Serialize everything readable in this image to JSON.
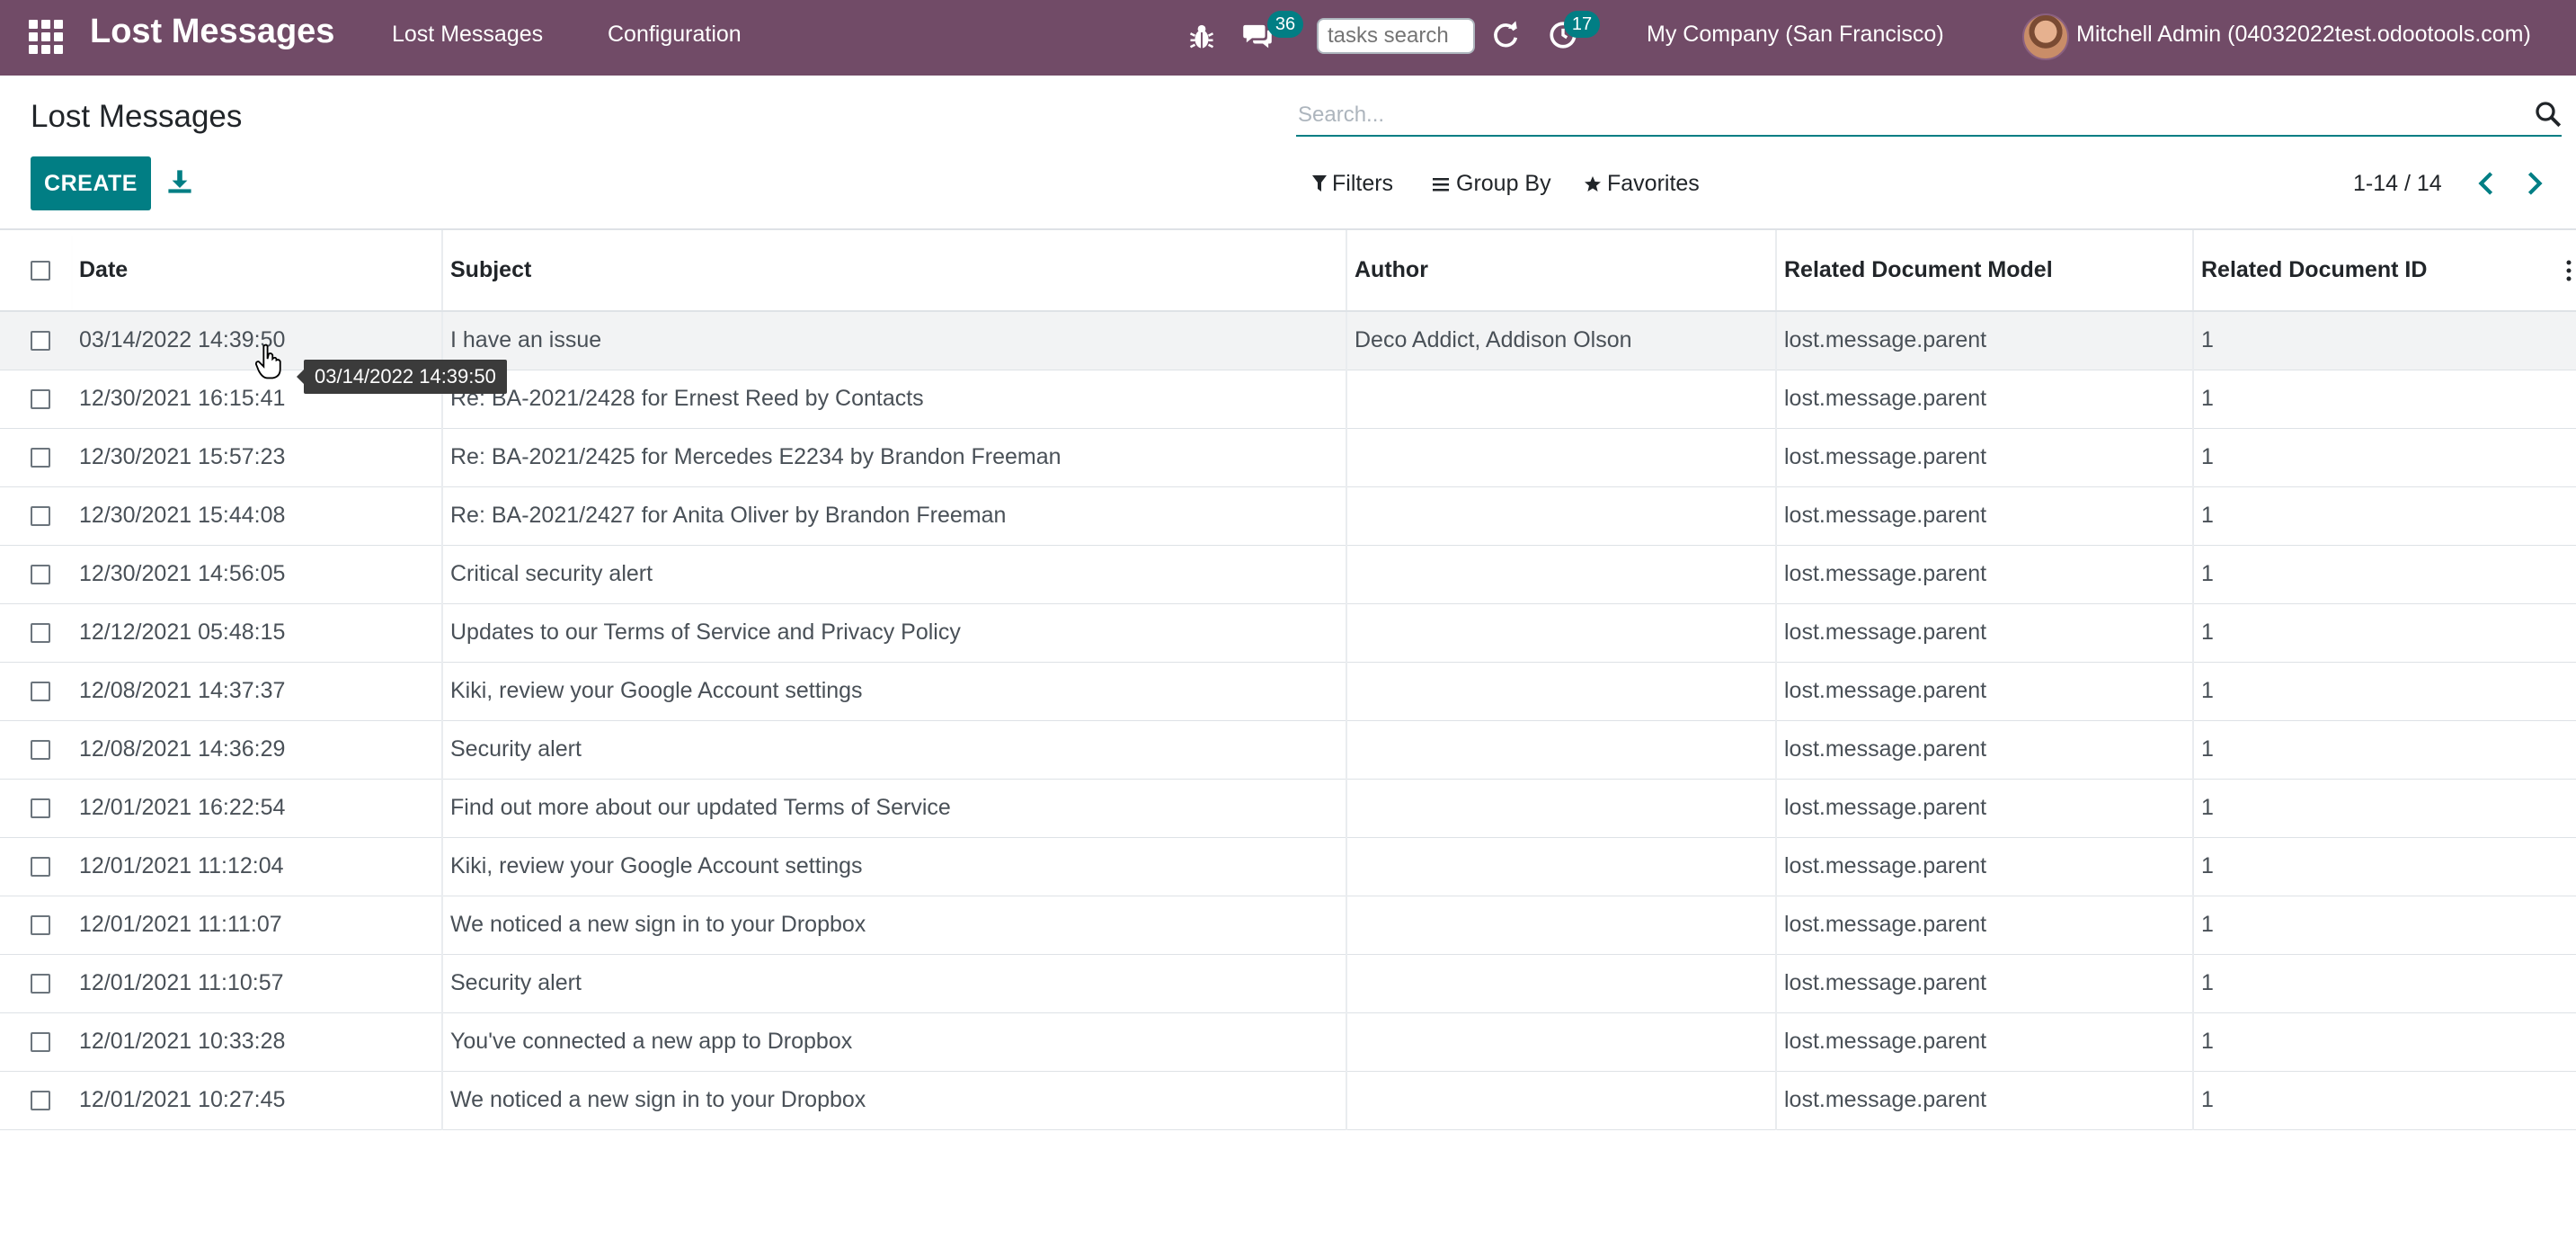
{
  "navbar": {
    "brand": "Lost Messages",
    "menu": [
      "Lost Messages",
      "Configuration"
    ],
    "chat_count": "36",
    "tasks_search_placeholder": "tasks search",
    "activity_count": "17",
    "company": "My Company (San Francisco)",
    "user": "Mitchell Admin (04032022test.odootools.com)"
  },
  "control_panel": {
    "title": "Lost Messages",
    "create_label": "CREATE",
    "search_placeholder": "Search...",
    "filters_label": "Filters",
    "group_by_label": "Group By",
    "favorites_label": "Favorites",
    "pager": "1-14 / 14"
  },
  "table": {
    "columns": [
      "Date",
      "Subject",
      "Author",
      "Related Document Model",
      "Related Document ID"
    ],
    "rows": [
      [
        "03/14/2022 14:39:50",
        "I have an issue",
        "Deco Addict, Addison Olson",
        "lost.message.parent",
        "1"
      ],
      [
        "12/30/2021 16:15:41",
        "Re: BA-2021/2428 for Ernest Reed by Contacts",
        "",
        "lost.message.parent",
        "1"
      ],
      [
        "12/30/2021 15:57:23",
        "Re: BA-2021/2425 for Mercedes E2234 by Brandon Freeman",
        "",
        "lost.message.parent",
        "1"
      ],
      [
        "12/30/2021 15:44:08",
        "Re: BA-2021/2427 for Anita Oliver by Brandon Freeman",
        "",
        "lost.message.parent",
        "1"
      ],
      [
        "12/30/2021 14:56:05",
        "Critical security alert",
        "",
        "lost.message.parent",
        "1"
      ],
      [
        "12/12/2021 05:48:15",
        "Updates to our Terms of Service and Privacy Policy",
        "",
        "lost.message.parent",
        "1"
      ],
      [
        "12/08/2021 14:37:37",
        "Kiki, review your Google Account settings",
        "",
        "lost.message.parent",
        "1"
      ],
      [
        "12/08/2021 14:36:29",
        "Security alert",
        "",
        "lost.message.parent",
        "1"
      ],
      [
        "12/01/2021 16:22:54",
        "Find out more about our updated Terms of Service",
        "",
        "lost.message.parent",
        "1"
      ],
      [
        "12/01/2021 11:12:04",
        "Kiki, review your Google Account settings",
        "",
        "lost.message.parent",
        "1"
      ],
      [
        "12/01/2021 11:11:07",
        "We noticed a new sign in to your Dropbox",
        "",
        "lost.message.parent",
        "1"
      ],
      [
        "12/01/2021 11:10:57",
        "Security alert",
        "",
        "lost.message.parent",
        "1"
      ],
      [
        "12/01/2021 10:33:28",
        "You've connected a new app to Dropbox",
        "",
        "lost.message.parent",
        "1"
      ],
      [
        "12/01/2021 10:27:45",
        "We noticed a new sign in to your Dropbox",
        "",
        "lost.message.parent",
        "1"
      ]
    ]
  },
  "tooltip": "03/14/2022 14:39:50",
  "colors": {
    "navbar": "#714b67",
    "primary": "#017e84",
    "row_hover": "#f2f3f4"
  },
  "icons": [
    "apps-grid-icon",
    "bug-icon",
    "chat-icon",
    "refresh-icon",
    "activity-clock-icon",
    "download-icon",
    "search-icon",
    "filter-icon",
    "group-by-icon",
    "star-icon",
    "chevron-left-icon",
    "chevron-right-icon",
    "kebab-menu-icon",
    "hand-cursor-icon"
  ]
}
